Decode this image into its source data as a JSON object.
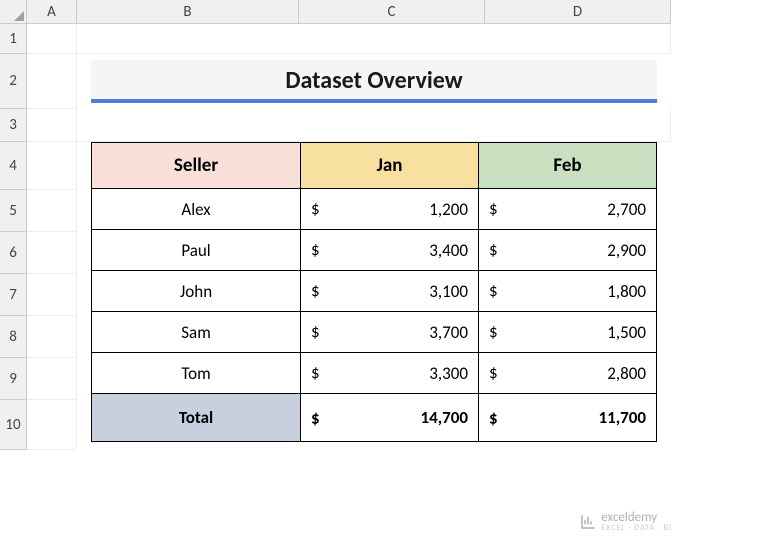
{
  "columns": [
    "A",
    "B",
    "C",
    "D"
  ],
  "rows": [
    "1",
    "2",
    "3",
    "4",
    "5",
    "6",
    "7",
    "8",
    "9",
    "10"
  ],
  "title": "Dataset Overview",
  "headers": {
    "seller": "Seller",
    "jan": "Jan",
    "feb": "Feb"
  },
  "currency_symbol": "$",
  "total_label": "Total",
  "chart_data": {
    "type": "table",
    "columns": [
      "Seller",
      "Jan",
      "Feb"
    ],
    "rows": [
      {
        "seller": "Alex",
        "jan": "1,200",
        "feb": "2,700"
      },
      {
        "seller": "Paul",
        "jan": "3,400",
        "feb": "2,900"
      },
      {
        "seller": "John",
        "jan": "3,100",
        "feb": "1,800"
      },
      {
        "seller": "Sam",
        "jan": "3,700",
        "feb": "1,500"
      },
      {
        "seller": "Tom",
        "jan": "3,300",
        "feb": "2,800"
      }
    ],
    "totals": {
      "jan": "14,700",
      "feb": "11,700"
    }
  },
  "watermark": {
    "name": "exceldemy",
    "sub": "EXCEL · DATA · BI"
  }
}
